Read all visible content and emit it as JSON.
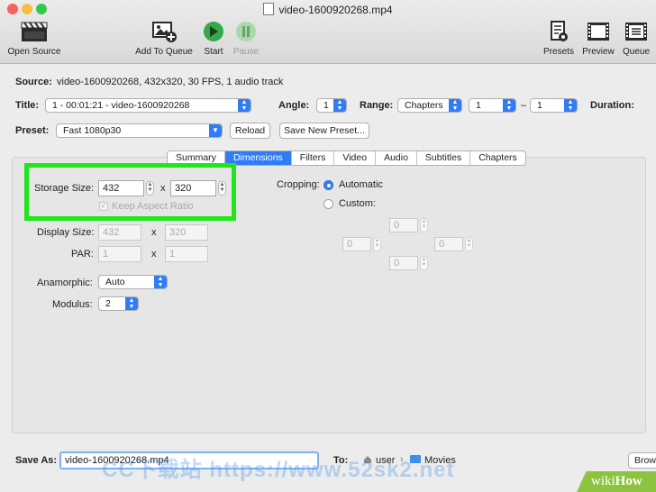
{
  "window": {
    "title": "video-1600920268.mp4",
    "traffic_colors": [
      "#fc605c",
      "#fdbc40",
      "#34c84a"
    ]
  },
  "toolbar": {
    "open_source": "Open Source",
    "add_to_queue": "Add To Queue",
    "start": "Start",
    "pause": "Pause",
    "presets": "Presets",
    "preview": "Preview",
    "queue": "Queue"
  },
  "source": {
    "label": "Source:",
    "value": "video-1600920268, 432x320, 30 FPS, 1 audio track"
  },
  "title_row": {
    "title_label": "Title:",
    "title_value": "1 - 00:01:21 - video-1600920268",
    "angle_label": "Angle:",
    "angle_value": "1",
    "range_label": "Range:",
    "range_value": "Chapters",
    "range_start": "1",
    "range_dash": "–",
    "range_end": "1",
    "duration_label": "Duration:"
  },
  "preset_row": {
    "label": "Preset:",
    "value": "Fast 1080p30",
    "reload": "Reload",
    "save_new": "Save New Preset..."
  },
  "tabs": [
    {
      "label": "Summary"
    },
    {
      "label": "Dimensions",
      "active": true
    },
    {
      "label": "Filters"
    },
    {
      "label": "Video"
    },
    {
      "label": "Audio"
    },
    {
      "label": "Subtitles"
    },
    {
      "label": "Chapters"
    }
  ],
  "dimensions": {
    "storage_label": "Storage Size:",
    "storage_width": "432",
    "storage_x": "x",
    "storage_height": "320",
    "keep_aspect": "Keep Aspect Ratio",
    "display_label": "Display Size:",
    "display_width": "432",
    "display_x": "x",
    "display_height": "320",
    "par_label": "PAR:",
    "par_width": "1",
    "par_x": "x",
    "par_height": "1",
    "anamorphic_label": "Anamorphic:",
    "anamorphic_value": "Auto",
    "modulus_label": "Modulus:",
    "modulus_value": "2",
    "cropping_label": "Cropping:",
    "crop_automatic": "Automatic",
    "crop_custom": "Custom:",
    "crop_top": "0",
    "crop_left": "0",
    "crop_right": "0",
    "crop_bottom": "0",
    "highlight_color": "#22e51b"
  },
  "save_row": {
    "label": "Save As:",
    "value": "video-1600920268.mp4",
    "to_label": "To:",
    "path_user": "user",
    "path_sep": "›",
    "path_folder": "Movies",
    "browse": "Brow"
  },
  "watermarks": {
    "site": "CC下载站 https://www.52sk2.net",
    "badge_wiki": "wiki",
    "badge_how": "How"
  },
  "colors": {
    "accent": "#2f7cf6",
    "play_green": "#35a84a",
    "badge_green": "#8dc43f"
  }
}
